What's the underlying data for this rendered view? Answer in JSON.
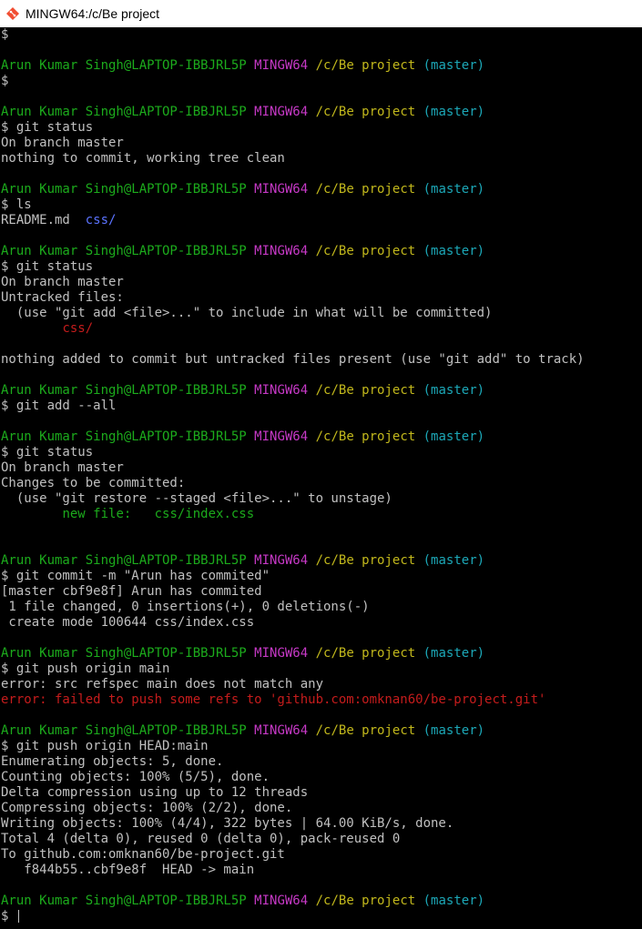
{
  "window": {
    "title": "MINGW64:/c/Be project",
    "icon": "git-bash-icon"
  },
  "colors": {
    "background": "#000000",
    "default_text": "#c0c0c0",
    "prompt_user": "#1cab1c",
    "prompt_system": "#c639c6",
    "prompt_path": "#c2b81c",
    "prompt_branch": "#1ca8b8",
    "directory": "#5b73ff",
    "error": "#c51c1c"
  },
  "terminal": {
    "lines": [
      {
        "segments": [
          {
            "text": "$",
            "color": "default"
          }
        ]
      },
      {
        "segments": []
      },
      {
        "segments": [
          {
            "text": "Arun Kumar Singh@LAPTOP-IBBJRL5P",
            "color": "user"
          },
          {
            "text": " ",
            "color": "default"
          },
          {
            "text": "MINGW64",
            "color": "mingw"
          },
          {
            "text": " ",
            "color": "default"
          },
          {
            "text": "/c/Be project",
            "color": "path"
          },
          {
            "text": " ",
            "color": "default"
          },
          {
            "text": "(master)",
            "color": "branch"
          }
        ]
      },
      {
        "segments": [
          {
            "text": "$",
            "color": "default"
          }
        ]
      },
      {
        "segments": []
      },
      {
        "segments": [
          {
            "text": "Arun Kumar Singh@LAPTOP-IBBJRL5P",
            "color": "user"
          },
          {
            "text": " ",
            "color": "default"
          },
          {
            "text": "MINGW64",
            "color": "mingw"
          },
          {
            "text": " ",
            "color": "default"
          },
          {
            "text": "/c/Be project",
            "color": "path"
          },
          {
            "text": " ",
            "color": "default"
          },
          {
            "text": "(master)",
            "color": "branch"
          }
        ]
      },
      {
        "segments": [
          {
            "text": "$ git status",
            "color": "default"
          }
        ]
      },
      {
        "segments": [
          {
            "text": "On branch master",
            "color": "default"
          }
        ]
      },
      {
        "segments": [
          {
            "text": "nothing to commit, working tree clean",
            "color": "default"
          }
        ]
      },
      {
        "segments": []
      },
      {
        "segments": [
          {
            "text": "Arun Kumar Singh@LAPTOP-IBBJRL5P",
            "color": "user"
          },
          {
            "text": " ",
            "color": "default"
          },
          {
            "text": "MINGW64",
            "color": "mingw"
          },
          {
            "text": " ",
            "color": "default"
          },
          {
            "text": "/c/Be project",
            "color": "path"
          },
          {
            "text": " ",
            "color": "default"
          },
          {
            "text": "(master)",
            "color": "branch"
          }
        ]
      },
      {
        "segments": [
          {
            "text": "$ ls",
            "color": "default"
          }
        ]
      },
      {
        "segments": [
          {
            "text": "README.md  ",
            "color": "default"
          },
          {
            "text": "css/",
            "color": "dir"
          }
        ]
      },
      {
        "segments": []
      },
      {
        "segments": [
          {
            "text": "Arun Kumar Singh@LAPTOP-IBBJRL5P",
            "color": "user"
          },
          {
            "text": " ",
            "color": "default"
          },
          {
            "text": "MINGW64",
            "color": "mingw"
          },
          {
            "text": " ",
            "color": "default"
          },
          {
            "text": "/c/Be project",
            "color": "path"
          },
          {
            "text": " ",
            "color": "default"
          },
          {
            "text": "(master)",
            "color": "branch"
          }
        ]
      },
      {
        "segments": [
          {
            "text": "$ git status",
            "color": "default"
          }
        ]
      },
      {
        "segments": [
          {
            "text": "On branch master",
            "color": "default"
          }
        ]
      },
      {
        "segments": [
          {
            "text": "Untracked files:",
            "color": "default"
          }
        ]
      },
      {
        "segments": [
          {
            "text": "  (use \"git add <file>...\" to include in what will be committed)",
            "color": "default"
          }
        ]
      },
      {
        "segments": [
          {
            "text": "        ",
            "color": "default"
          },
          {
            "text": "css/",
            "color": "red"
          }
        ]
      },
      {
        "segments": []
      },
      {
        "segments": [
          {
            "text": "nothing added to commit but untracked files present (use \"git add\" to track)",
            "color": "default"
          }
        ]
      },
      {
        "segments": []
      },
      {
        "segments": [
          {
            "text": "Arun Kumar Singh@LAPTOP-IBBJRL5P",
            "color": "user"
          },
          {
            "text": " ",
            "color": "default"
          },
          {
            "text": "MINGW64",
            "color": "mingw"
          },
          {
            "text": " ",
            "color": "default"
          },
          {
            "text": "/c/Be project",
            "color": "path"
          },
          {
            "text": " ",
            "color": "default"
          },
          {
            "text": "(master)",
            "color": "branch"
          }
        ]
      },
      {
        "segments": [
          {
            "text": "$ git add --all",
            "color": "default"
          }
        ]
      },
      {
        "segments": []
      },
      {
        "segments": [
          {
            "text": "Arun Kumar Singh@LAPTOP-IBBJRL5P",
            "color": "user"
          },
          {
            "text": " ",
            "color": "default"
          },
          {
            "text": "MINGW64",
            "color": "mingw"
          },
          {
            "text": " ",
            "color": "default"
          },
          {
            "text": "/c/Be project",
            "color": "path"
          },
          {
            "text": " ",
            "color": "default"
          },
          {
            "text": "(master)",
            "color": "branch"
          }
        ]
      },
      {
        "segments": [
          {
            "text": "$ git status",
            "color": "default"
          }
        ]
      },
      {
        "segments": [
          {
            "text": "On branch master",
            "color": "default"
          }
        ]
      },
      {
        "segments": [
          {
            "text": "Changes to be committed:",
            "color": "default"
          }
        ]
      },
      {
        "segments": [
          {
            "text": "  (use \"git restore --staged <file>...\" to unstage)",
            "color": "default"
          }
        ]
      },
      {
        "segments": [
          {
            "text": "        ",
            "color": "default"
          },
          {
            "text": "new file:   css/index.css",
            "color": "user"
          }
        ]
      },
      {
        "segments": []
      },
      {
        "segments": []
      },
      {
        "segments": [
          {
            "text": "Arun Kumar Singh@LAPTOP-IBBJRL5P",
            "color": "user"
          },
          {
            "text": " ",
            "color": "default"
          },
          {
            "text": "MINGW64",
            "color": "mingw"
          },
          {
            "text": " ",
            "color": "default"
          },
          {
            "text": "/c/Be project",
            "color": "path"
          },
          {
            "text": " ",
            "color": "default"
          },
          {
            "text": "(master)",
            "color": "branch"
          }
        ]
      },
      {
        "segments": [
          {
            "text": "$ git commit -m \"Arun has commited\"",
            "color": "default"
          }
        ]
      },
      {
        "segments": [
          {
            "text": "[master cbf9e8f] Arun has commited",
            "color": "default"
          }
        ]
      },
      {
        "segments": [
          {
            "text": " 1 file changed, 0 insertions(+), 0 deletions(-)",
            "color": "default"
          }
        ]
      },
      {
        "segments": [
          {
            "text": " create mode 100644 css/index.css",
            "color": "default"
          }
        ]
      },
      {
        "segments": []
      },
      {
        "segments": [
          {
            "text": "Arun Kumar Singh@LAPTOP-IBBJRL5P",
            "color": "user"
          },
          {
            "text": " ",
            "color": "default"
          },
          {
            "text": "MINGW64",
            "color": "mingw"
          },
          {
            "text": " ",
            "color": "default"
          },
          {
            "text": "/c/Be project",
            "color": "path"
          },
          {
            "text": " ",
            "color": "default"
          },
          {
            "text": "(master)",
            "color": "branch"
          }
        ]
      },
      {
        "segments": [
          {
            "text": "$ git push origin main",
            "color": "default"
          }
        ]
      },
      {
        "segments": [
          {
            "text": "error: src refspec main does not match any",
            "color": "default"
          }
        ]
      },
      {
        "segments": [
          {
            "text": "error: failed to push some refs to 'github.com:omknan60/be-project.git'",
            "color": "red"
          }
        ]
      },
      {
        "segments": []
      },
      {
        "segments": [
          {
            "text": "Arun Kumar Singh@LAPTOP-IBBJRL5P",
            "color": "user"
          },
          {
            "text": " ",
            "color": "default"
          },
          {
            "text": "MINGW64",
            "color": "mingw"
          },
          {
            "text": " ",
            "color": "default"
          },
          {
            "text": "/c/Be project",
            "color": "path"
          },
          {
            "text": " ",
            "color": "default"
          },
          {
            "text": "(master)",
            "color": "branch"
          }
        ]
      },
      {
        "segments": [
          {
            "text": "$ git push origin HEAD:main",
            "color": "default"
          }
        ]
      },
      {
        "segments": [
          {
            "text": "Enumerating objects: 5, done.",
            "color": "default"
          }
        ]
      },
      {
        "segments": [
          {
            "text": "Counting objects: 100% (5/5), done.",
            "color": "default"
          }
        ]
      },
      {
        "segments": [
          {
            "text": "Delta compression using up to 12 threads",
            "color": "default"
          }
        ]
      },
      {
        "segments": [
          {
            "text": "Compressing objects: 100% (2/2), done.",
            "color": "default"
          }
        ]
      },
      {
        "segments": [
          {
            "text": "Writing objects: 100% (4/4), 322 bytes | 64.00 KiB/s, done.",
            "color": "default"
          }
        ]
      },
      {
        "segments": [
          {
            "text": "Total 4 (delta 0), reused 0 (delta 0), pack-reused 0",
            "color": "default"
          }
        ]
      },
      {
        "segments": [
          {
            "text": "To github.com:omknan60/be-project.git",
            "color": "default"
          }
        ]
      },
      {
        "segments": [
          {
            "text": "   f844b55..cbf9e8f  HEAD -> main",
            "color": "default"
          }
        ]
      },
      {
        "segments": []
      },
      {
        "segments": [
          {
            "text": "Arun Kumar Singh@LAPTOP-IBBJRL5P",
            "color": "user"
          },
          {
            "text": " ",
            "color": "default"
          },
          {
            "text": "MINGW64",
            "color": "mingw"
          },
          {
            "text": " ",
            "color": "default"
          },
          {
            "text": "/c/Be project",
            "color": "path"
          },
          {
            "text": " ",
            "color": "default"
          },
          {
            "text": "(master)",
            "color": "branch"
          }
        ]
      },
      {
        "segments": [
          {
            "text": "$ ",
            "color": "default"
          }
        ],
        "cursor": true
      }
    ]
  }
}
